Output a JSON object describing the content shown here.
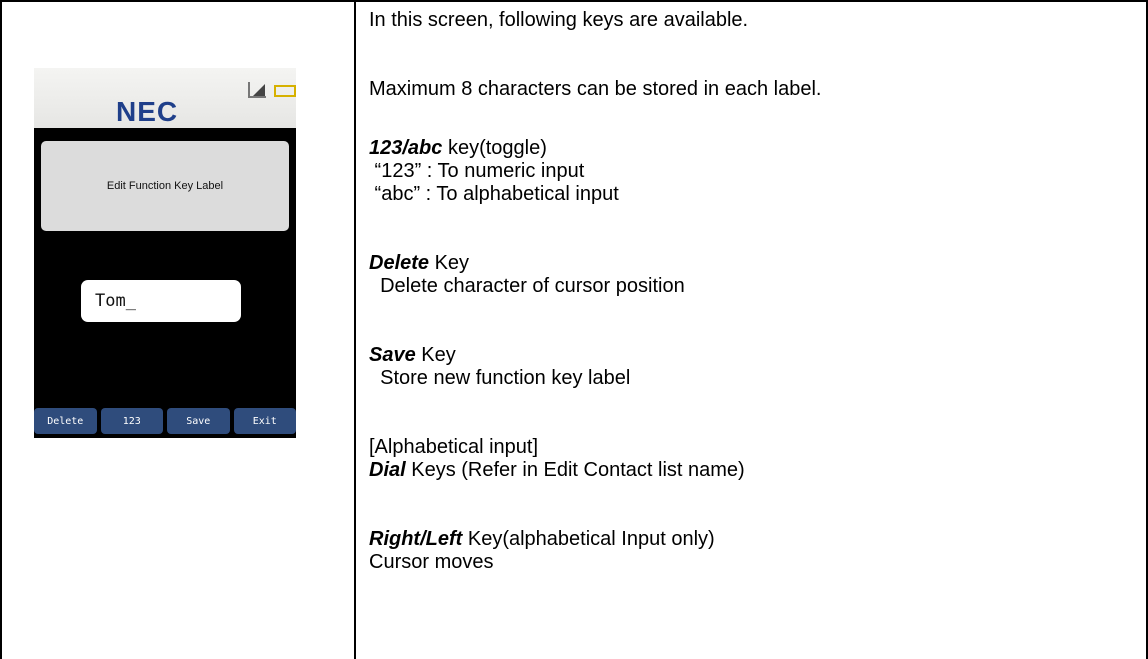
{
  "phone": {
    "brand": "NEC",
    "screen_title": "Edit Function Key Label",
    "input_value": "Tom_",
    "softkeys": [
      "Delete",
      "123",
      "Save",
      "Exit"
    ]
  },
  "description": {
    "intro": "In this screen, following keys are available.",
    "max_chars": "Maximum 8 characters can be stored in each label.",
    "toggle_key": {
      "name": "123/abc",
      "suffix": " key(toggle)",
      "lines": [
        " “123” : To numeric input",
        " “abc” : To alphabetical input"
      ]
    },
    "delete_key": {
      "name": "Delete",
      "suffix": " Key",
      "desc": "  Delete character of cursor position"
    },
    "save_key": {
      "name": "Save",
      "suffix": " Key",
      "desc": "  Store new function key label"
    },
    "alpha_heading": "[Alphabetical input]",
    "dial_key": {
      "name": "Dial",
      "suffix": " Keys (Refer in Edit Contact list name)"
    },
    "rightleft_key": {
      "name": "Right/Left",
      "suffix": " Key(alphabetical Input only)",
      "desc": "Cursor moves"
    }
  }
}
